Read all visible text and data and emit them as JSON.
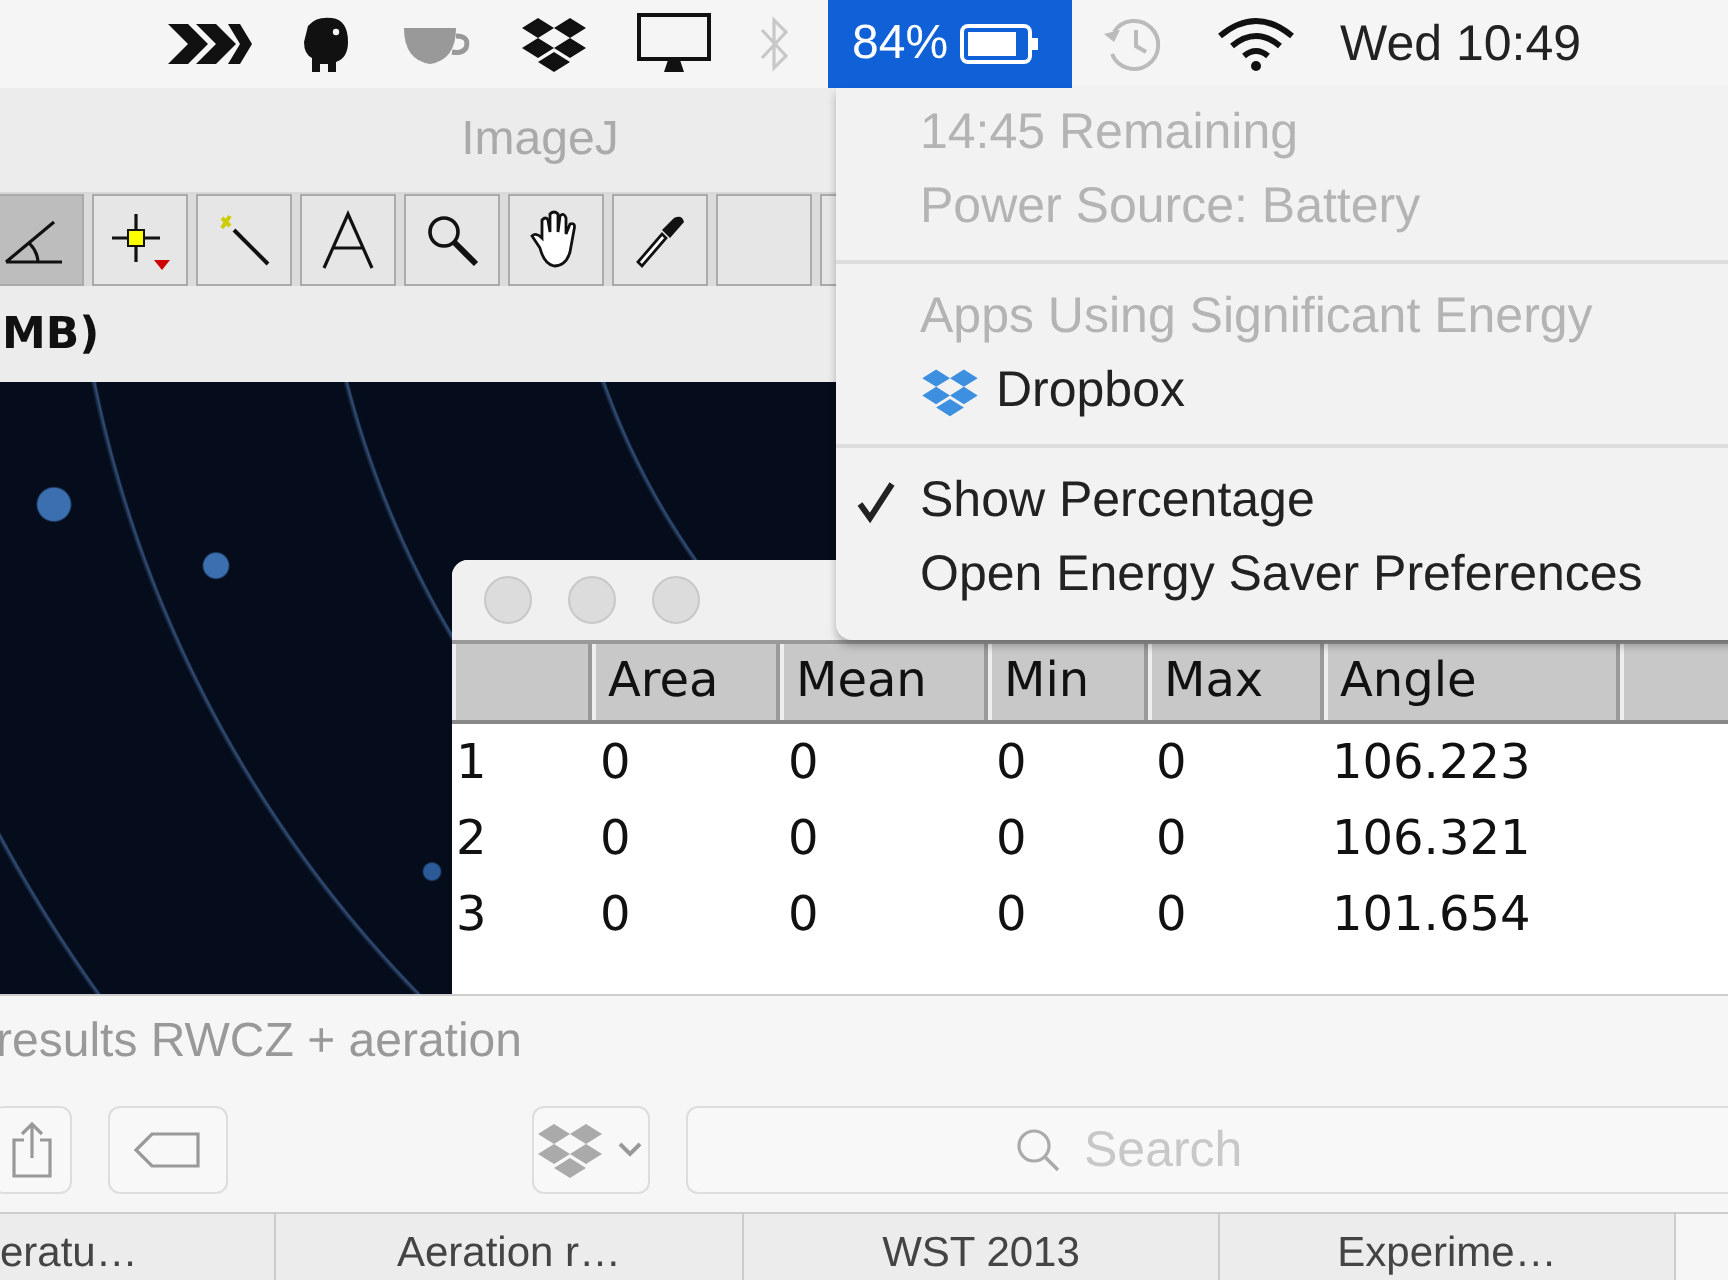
{
  "menubar": {
    "battery": {
      "percent": "84%",
      "selected": true
    },
    "bluetooth": {
      "disabled": true
    },
    "clock": "Wed 10:49"
  },
  "imagej": {
    "title": "ImageJ",
    "tools": [
      {
        "kind": "angle",
        "selected": true
      },
      {
        "kind": "point",
        "selected": false
      },
      {
        "kind": "wand",
        "selected": false
      },
      {
        "kind": "text",
        "selected": false
      },
      {
        "kind": "magnifier",
        "selected": false
      },
      {
        "kind": "hand",
        "selected": false
      },
      {
        "kind": "dropper",
        "selected": false
      },
      {
        "kind": "empty",
        "selected": false
      },
      {
        "kind": "empty",
        "selected": false
      }
    ],
    "status": "MB)"
  },
  "results": {
    "columns": [
      "",
      "Area",
      "Mean",
      "Min",
      "Max",
      "Angle"
    ],
    "rows": [
      [
        "1",
        "0",
        "0",
        "0",
        "0",
        "106.223"
      ],
      [
        "2",
        "0",
        "0",
        "0",
        "0",
        "106.321"
      ],
      [
        "3",
        "0",
        "0",
        "0",
        "0",
        "101.654"
      ]
    ]
  },
  "battery_menu": {
    "info": [
      "14:45 Remaining",
      "Power Source: Battery"
    ],
    "section_title": "Apps Using Significant Energy",
    "apps": [
      "Dropbox"
    ],
    "options": [
      {
        "label": "Show Percentage",
        "checked": true
      },
      {
        "label": "Open Energy Saver Preferences",
        "checked": false
      }
    ]
  },
  "finder": {
    "title": "results RWCZ + aeration",
    "search": {
      "placeholder": "Search"
    },
    "tabs": [
      {
        "label": "eratu…",
        "selected": false
      },
      {
        "label": "Aeration r…",
        "selected": false
      },
      {
        "label": "WST 2013",
        "selected": false
      },
      {
        "label": "Experime…",
        "selected": false
      }
    ]
  }
}
